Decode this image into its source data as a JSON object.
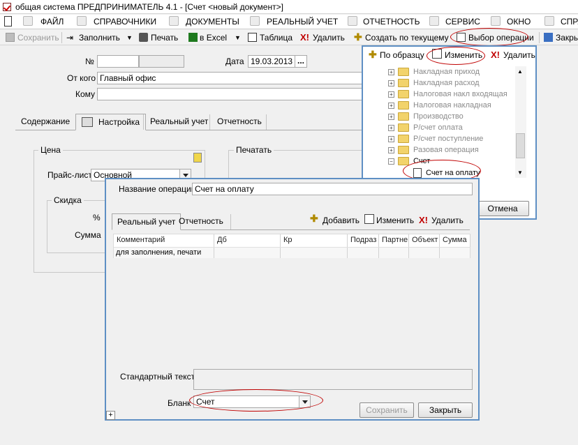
{
  "window": {
    "title": "общая система  ПРЕДПРИНИМАТЕЛЬ 4.1 - [Счет <новый документ>]"
  },
  "menu": {
    "items": [
      "ФАЙЛ",
      "СПРАВОЧНИКИ",
      "ДОКУМЕНТЫ",
      "РЕАЛЬНЫЙ УЧЕТ",
      "ОТЧЕТНОСТЬ",
      "СЕРВИС",
      "ОКНО",
      "СПРА"
    ]
  },
  "toolbar": {
    "save": "Сохранить",
    "fill": "Заполнить",
    "print": "Печать",
    "excel": "в Excel",
    "table": "Таблица",
    "delete": "Удалить",
    "create_by": "Создать по текущему",
    "select_op": "Выбор операции",
    "close": "Закры"
  },
  "form": {
    "number_label": "№",
    "number_value": "",
    "date_label": "Дата",
    "date_value": "19.03.2013",
    "date_btn": "...",
    "from_label": "От кого",
    "from_value": "Главный офис",
    "to_label": "Кому",
    "to_value": ""
  },
  "tabs": [
    "Содержание",
    "Настройка",
    "Реальный учет",
    "Отчетность"
  ],
  "settings": {
    "price_group": "Цена",
    "price_list_label": "Прайс-лист",
    "price_list_value": "Основной",
    "discount_group": "Скидка",
    "percent_label": "%",
    "sum_label": "Сумма",
    "print_group": "Печатать"
  },
  "tree_panel": {
    "by_sample": "По образцу",
    "edit": "Изменить",
    "delete": "Удалить",
    "items": [
      "Накладная приход",
      "Накладная расход",
      "Налоговая накл входящая",
      "Налоговая накладная",
      "Производство",
      "Р/счет оплата",
      "Р/счет поступление",
      "Разовая операция",
      "Счет"
    ],
    "selected_child": "Счет на оплату",
    "cancel": "Отмена"
  },
  "dialog": {
    "op_name_label": "Название операции",
    "op_name_value": "Счет на оплату",
    "tabs": [
      "Реальный учет",
      "Отчетность"
    ],
    "add": "Добавить",
    "edit": "Изменить",
    "delete": "Удалить",
    "columns": [
      "Комментарий",
      "Дб",
      "Кр",
      "Подраз",
      "Партне",
      "Объект",
      "Сумма"
    ],
    "first_row": "для заполнения, печати",
    "std_text_label": "Стандартный текст",
    "blank_label": "Бланк",
    "blank_value": "Счет",
    "save": "Сохранить",
    "close": "Закрыть",
    "corner": "+"
  }
}
